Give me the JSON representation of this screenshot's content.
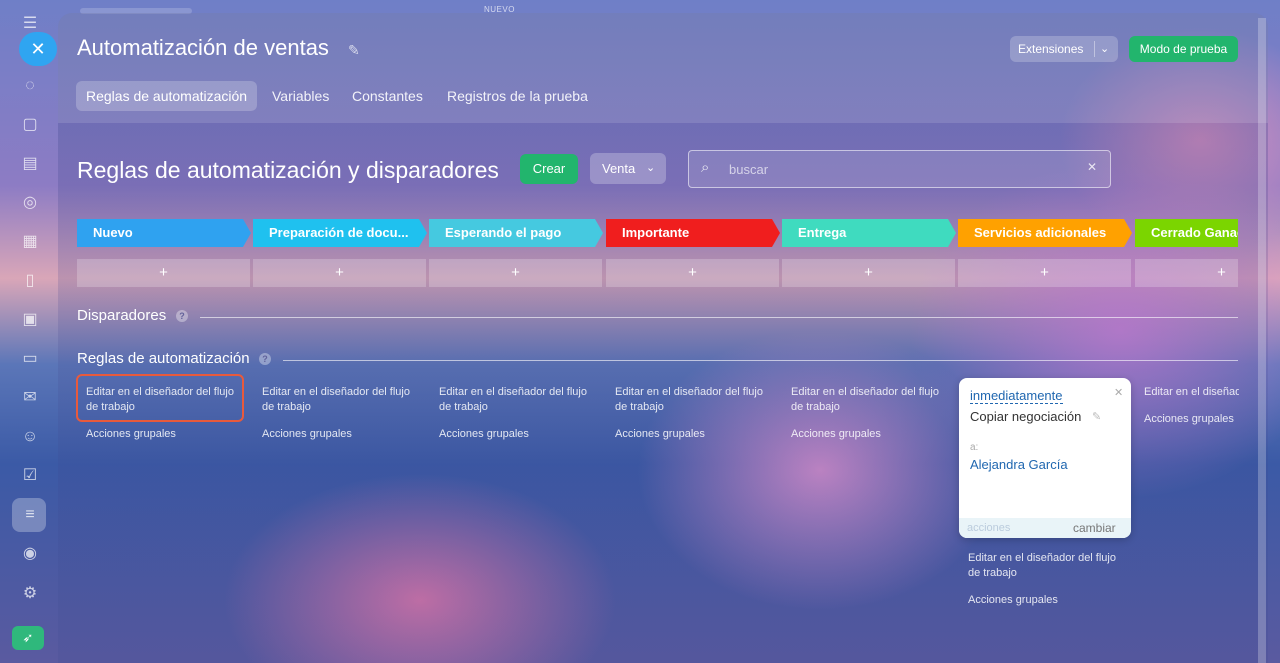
{
  "top": {
    "stage_hint": "NUEVO"
  },
  "sidebar": {
    "close_icon": "close-icon",
    "icons": [
      "chat-icon",
      "messages-icon",
      "document-icon",
      "circle-icon",
      "calendar-icon",
      "file-icon",
      "presentation-icon",
      "card-icon",
      "mail-icon",
      "users-icon",
      "checkbox-icon",
      "funnel-icon",
      "robot-icon",
      "settings-icon",
      "rocket-icon"
    ]
  },
  "header": {
    "title": "Automatización de ventas",
    "extensions_label": "Extensiones",
    "test_mode_label": "Modo de prueba",
    "tabs": [
      {
        "label": "Reglas de automatización",
        "active": true
      },
      {
        "label": "Variables"
      },
      {
        "label": "Constantes"
      },
      {
        "label": "Registros de la prueba"
      }
    ]
  },
  "toolbar": {
    "section_title": "Reglas de automatización y disparadores",
    "create_label": "Crear",
    "pipeline_label": "Venta",
    "search_placeholder": "buscar"
  },
  "stages": [
    {
      "label": "Nuevo",
      "color": "#2fa2f0"
    },
    {
      "label": "Preparación de docu...",
      "color": "#1fc1ef"
    },
    {
      "label": "Esperando el pago",
      "color": "#45c9e0"
    },
    {
      "label": "Importante",
      "color": "#f01e1e"
    },
    {
      "label": "Entrega",
      "color": "#3fdbbf"
    },
    {
      "label": "Servicios adicionales",
      "color": "#ffa100"
    },
    {
      "label": "Cerrado Ganado",
      "color": "#7bd500"
    }
  ],
  "add_symbol": "+",
  "sections": {
    "triggers": "Disparadores",
    "rules": "Reglas de automatización",
    "help_symbol": "?"
  },
  "column_texts": {
    "edit": "Editar en el diseñador del flujo de trabajo",
    "group": "Acciones grupales"
  },
  "card": {
    "when": "inmediatamente",
    "title": "Copiar negociación",
    "to_label": "a:",
    "to_user": "Alejandra García",
    "actions_label": "acciones",
    "change_label": "cambiar"
  }
}
